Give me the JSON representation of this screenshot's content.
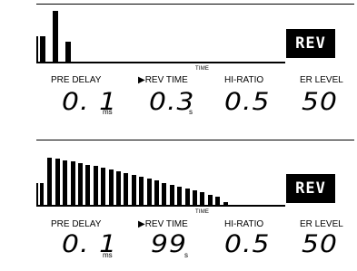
{
  "panels": [
    {
      "badge": "REV",
      "axis_label": "TIME",
      "params": [
        {
          "label": "PRE DELAY",
          "value": "0. 1",
          "unit": "ms",
          "selected": false
        },
        {
          "label": "▶REV TIME",
          "value": "0.3",
          "unit": "s",
          "selected": true
        },
        {
          "label": "HI-RATIO",
          "value": "0.5",
          "unit": "",
          "selected": false
        },
        {
          "label": "ER LEVEL",
          "value": "50",
          "unit": "",
          "selected": false
        }
      ],
      "bar_levels": [
        0.5,
        1.0,
        0.4
      ]
    },
    {
      "badge": "REV",
      "axis_label": "TIME",
      "params": [
        {
          "label": "PRE DELAY",
          "value": "0. 1",
          "unit": "ms",
          "selected": false
        },
        {
          "label": "▶REV TIME",
          "value": "99",
          "unit": "s",
          "selected": true
        },
        {
          "label": "HI-RATIO",
          "value": "0.5",
          "unit": "",
          "selected": false
        },
        {
          "label": "ER LEVEL",
          "value": "50",
          "unit": "",
          "selected": false
        }
      ],
      "bar_levels": [
        0.47,
        1.0,
        0.98,
        0.95,
        0.92,
        0.89,
        0.85,
        0.82,
        0.78,
        0.75,
        0.71,
        0.67,
        0.63,
        0.59,
        0.55,
        0.51,
        0.47,
        0.43,
        0.39,
        0.35,
        0.31,
        0.27,
        0.22,
        0.18,
        0.06
      ]
    }
  ]
}
